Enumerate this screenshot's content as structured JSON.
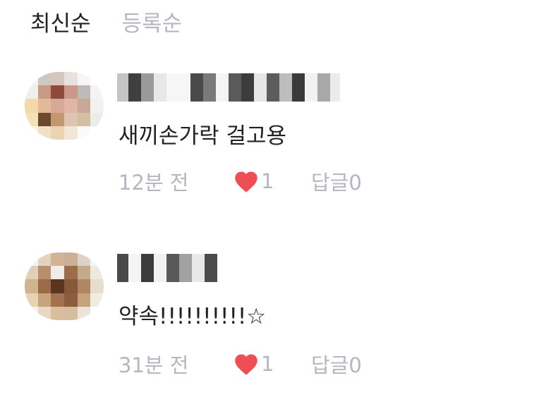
{
  "sort": {
    "latest_label": "최신순",
    "registered_label": "등록순"
  },
  "comments": [
    {
      "text": "새끼손가락 걸고용",
      "time": "12분 전",
      "like_count": "1",
      "reply_label": "답글",
      "reply_count": "0",
      "avatar_icon": "blurred-profile-photo",
      "author_icon": "blurred-username"
    },
    {
      "text": "약속!!!!!!!!!!☆",
      "time": "31분 전",
      "like_count": "1",
      "reply_label": "답글",
      "reply_count": "0",
      "avatar_icon": "blurred-profile-photo",
      "author_icon": "blurred-username"
    }
  ],
  "colors": {
    "heart": "#f04e55",
    "muted_text": "#b3b7bf",
    "main_text": "#222222"
  }
}
